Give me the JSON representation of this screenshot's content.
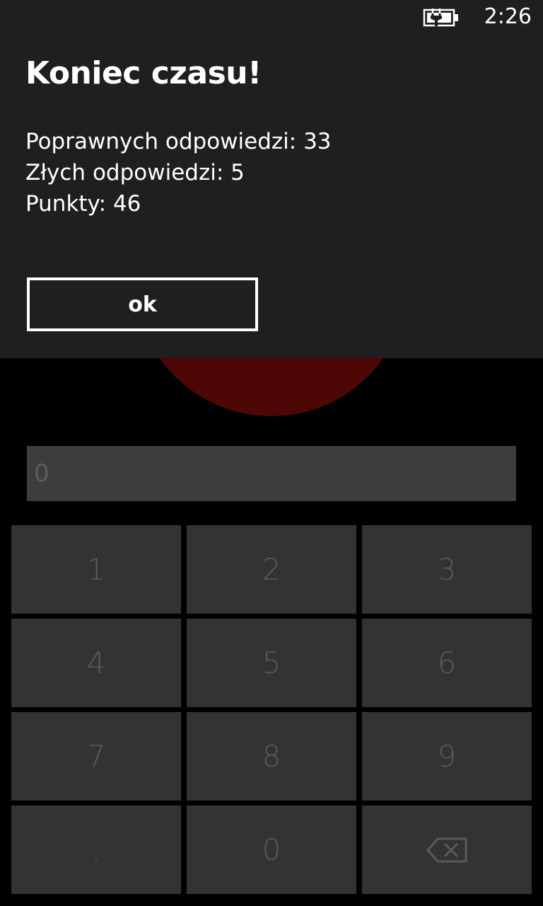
{
  "status_bar": {
    "time": "2:26",
    "battery_icon": "battery-charging-icon"
  },
  "dialog": {
    "title": "Koniec czasu!",
    "stats": {
      "correct_label": "Poprawnych odpowiedzi:",
      "correct_value": "33",
      "wrong_label": "Złych odpowiedzi:",
      "wrong_value": "5",
      "points_label": "Punkty:",
      "points_value": "46"
    },
    "ok_label": "ok"
  },
  "answer_field": {
    "value": "0"
  },
  "keypad": {
    "keys": [
      "1",
      "2",
      "3",
      "4",
      "5",
      "6",
      "7",
      "8",
      "9",
      ".",
      "0"
    ],
    "backspace_icon": "backspace-icon"
  },
  "colors": {
    "dialog_background": "#1f1f1f",
    "circle": "#4d0704",
    "key_background": "#333333",
    "input_background": "#3d3d3d"
  }
}
